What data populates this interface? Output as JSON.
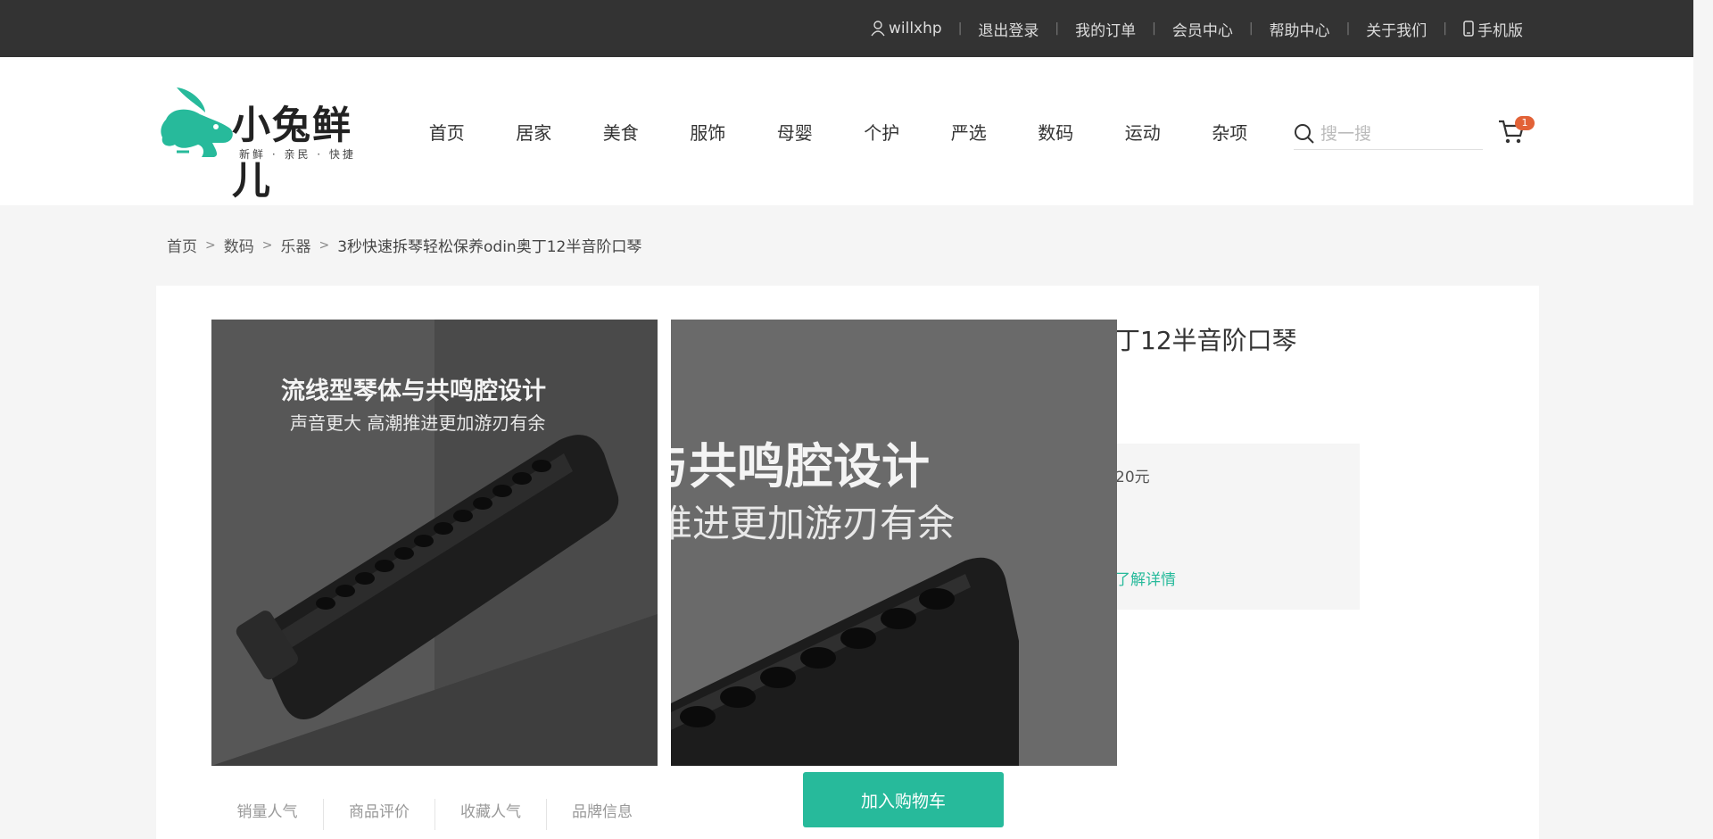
{
  "topbar": {
    "username": "willxhp",
    "links": [
      "退出登录",
      "我的订单",
      "会员中心",
      "帮助中心",
      "关于我们"
    ],
    "mobile": "手机版"
  },
  "logo": {
    "title": "小兔鲜儿",
    "subtitle": "新鲜 · 亲民 · 快捷"
  },
  "nav": {
    "items": [
      "首页",
      "居家",
      "美食",
      "服饰",
      "母婴",
      "个护",
      "严选",
      "数码",
      "运动",
      "杂项"
    ]
  },
  "search": {
    "placeholder": "搜一搜"
  },
  "cart": {
    "count": "1"
  },
  "breadcrumb": {
    "items": [
      "首页",
      "数码",
      "乐器",
      "3秒快速拆琴轻松保养odin奥丁12半音阶口琴"
    ]
  },
  "product": {
    "title_visible": "丁12半音阶口琴",
    "price_fragment": "20元",
    "detail_link": "了解详情",
    "image_text_line1": "流线型琴体与共鸣腔设计",
    "image_text_line2": "声音更大 高潮推进更加游刃有余",
    "zoom_text_line1": "与共鸣腔设计",
    "zoom_text_line2": "推进更加游刃有余",
    "add_to_cart": "加入购物车"
  },
  "stats": [
    {
      "label": "销量人气"
    },
    {
      "label": "商品评价"
    },
    {
      "label": "收藏人气"
    },
    {
      "label": "品牌信息"
    }
  ],
  "colors": {
    "brand": "#27ba9b",
    "topbar": "#333333",
    "badge": "#e26237"
  }
}
